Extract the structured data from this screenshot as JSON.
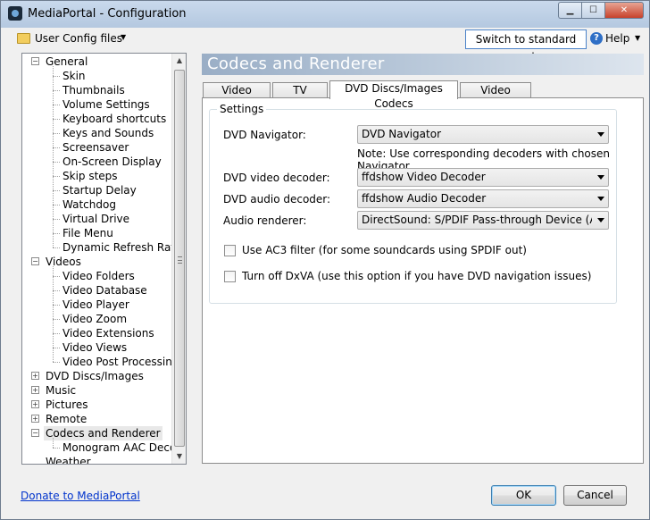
{
  "window": {
    "title": "MediaPortal - Configuration"
  },
  "toolbar": {
    "user_config": "User Config files",
    "switch_mode": "Switch to standard mode",
    "help": "Help"
  },
  "tree": {
    "items": [
      {
        "label": "General",
        "level": 0,
        "expanded": true
      },
      {
        "label": "Skin",
        "level": 1
      },
      {
        "label": "Thumbnails",
        "level": 1
      },
      {
        "label": "Volume Settings",
        "level": 1
      },
      {
        "label": "Keyboard shortcuts",
        "level": 1
      },
      {
        "label": "Keys and Sounds",
        "level": 1
      },
      {
        "label": "Screensaver",
        "level": 1
      },
      {
        "label": "On-Screen Display",
        "level": 1
      },
      {
        "label": "Skip steps",
        "level": 1
      },
      {
        "label": "Startup Delay",
        "level": 1
      },
      {
        "label": "Watchdog",
        "level": 1
      },
      {
        "label": "Virtual Drive",
        "level": 1
      },
      {
        "label": "File Menu",
        "level": 1
      },
      {
        "label": "Dynamic Refresh Rate",
        "level": 1
      },
      {
        "label": "Videos",
        "level": 0,
        "expanded": true
      },
      {
        "label": "Video Folders",
        "level": 1
      },
      {
        "label": "Video Database",
        "level": 1
      },
      {
        "label": "Video Player",
        "level": 1
      },
      {
        "label": "Video Zoom",
        "level": 1
      },
      {
        "label": "Video Extensions",
        "level": 1
      },
      {
        "label": "Video Views",
        "level": 1
      },
      {
        "label": "Video Post Processing",
        "level": 1
      },
      {
        "label": "DVD Discs/Images",
        "level": 0,
        "expanded": false
      },
      {
        "label": "Music",
        "level": 0,
        "expanded": false
      },
      {
        "label": "Pictures",
        "level": 0,
        "expanded": false
      },
      {
        "label": "Remote",
        "level": 0,
        "expanded": false
      },
      {
        "label": "Codecs and Renderer",
        "level": 0,
        "expanded": true,
        "selected": true
      },
      {
        "label": "Monogram AAC Decoder",
        "level": 1
      },
      {
        "label": "Weather",
        "level": 0
      }
    ]
  },
  "header": {
    "title": "Codecs and Renderer"
  },
  "tabs": [
    {
      "label": "Video Codecs"
    },
    {
      "label": "TV Codecs"
    },
    {
      "label": "DVD Discs/Images Codecs",
      "active": true
    },
    {
      "label": "Video Renderer"
    }
  ],
  "settings": {
    "group_title": "Settings",
    "dvd_navigator_label": "DVD Navigator:",
    "dvd_navigator_value": "DVD Navigator",
    "note": "Note: Use corresponding decoders with chosen Navigator",
    "dvd_video_label": "DVD video decoder:",
    "dvd_video_value": "ffdshow Video Decoder",
    "dvd_audio_label": "DVD audio decoder:",
    "dvd_audio_value": "ffdshow Audio Decoder",
    "audio_renderer_label": "Audio renderer:",
    "audio_renderer_value": "DirectSound: S/PDIF Pass-through Device (ASUS Xonar",
    "ac3_label": "Use AC3 filter (for some soundcards using SPDIF out)",
    "ac3_checked": false,
    "dxva_label": "Turn off DxVA (use this option if you have DVD navigation issues)",
    "dxva_checked": false
  },
  "footer": {
    "donate": "Donate to MediaPortal",
    "ok": "OK",
    "cancel": "Cancel"
  }
}
